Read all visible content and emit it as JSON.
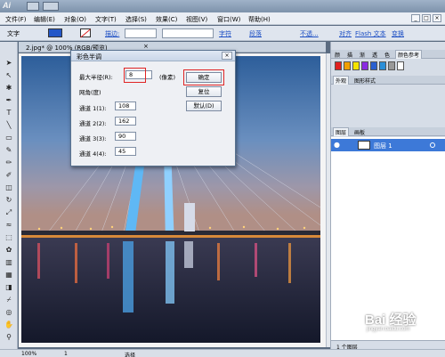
{
  "app": {
    "logo": "Ai"
  },
  "menubar": {
    "items": [
      "文件(F)",
      "编辑(E)",
      "对象(O)",
      "文字(T)",
      "选择(S)",
      "效果(C)",
      "视图(V)",
      "窗口(W)",
      "帮助(H)"
    ]
  },
  "ctrlbar": {
    "label_text": "文字",
    "stroke_label": "描边:",
    "char_label": "字符",
    "para_label": "段落",
    "opacity_label": "不透...",
    "align_label": "对齐",
    "transform_label": "变换",
    "flash_label": "Flash 文本",
    "fill_color": "#2357c8"
  },
  "document": {
    "tab_title": "2.jpg* @ 100% (RGB/预览)"
  },
  "dialog": {
    "title": "彩色半调",
    "max_radius_label": "最大半径(R):",
    "max_radius_value": "8",
    "unit_label": "(像素)",
    "screen_angle_label": "网角(度)",
    "channels": [
      {
        "label": "通道 1(1):",
        "value": "108"
      },
      {
        "label": "通道 2(2):",
        "value": "162"
      },
      {
        "label": "通道 3(3):",
        "value": "90"
      },
      {
        "label": "通道 4(4):",
        "value": "45"
      }
    ],
    "ok_label": "确定",
    "cancel_label": "复位",
    "default_label": "默认(D)"
  },
  "rightpanel": {
    "top_tabs": [
      "颜",
      "描",
      "渐",
      "透",
      "色",
      "颜色参考"
    ],
    "mid_tabs": [
      "外观",
      "图形样式"
    ],
    "layer_tabs": [
      "图层",
      "画板"
    ],
    "layer_name": "图层 1",
    "layers_count": "1 个图层",
    "swatches": [
      "#e02020",
      "#f0a000",
      "#f5e400",
      "#8a2be2",
      "#2b5fcf",
      "#2b8fd8",
      "#999999",
      "#ffffff"
    ]
  },
  "statusbar": {
    "zoom": "100%",
    "page": "1",
    "tool": "选择"
  },
  "watermark": {
    "brand": "Bai 经验",
    "url": "jingyan.baidu.com"
  }
}
